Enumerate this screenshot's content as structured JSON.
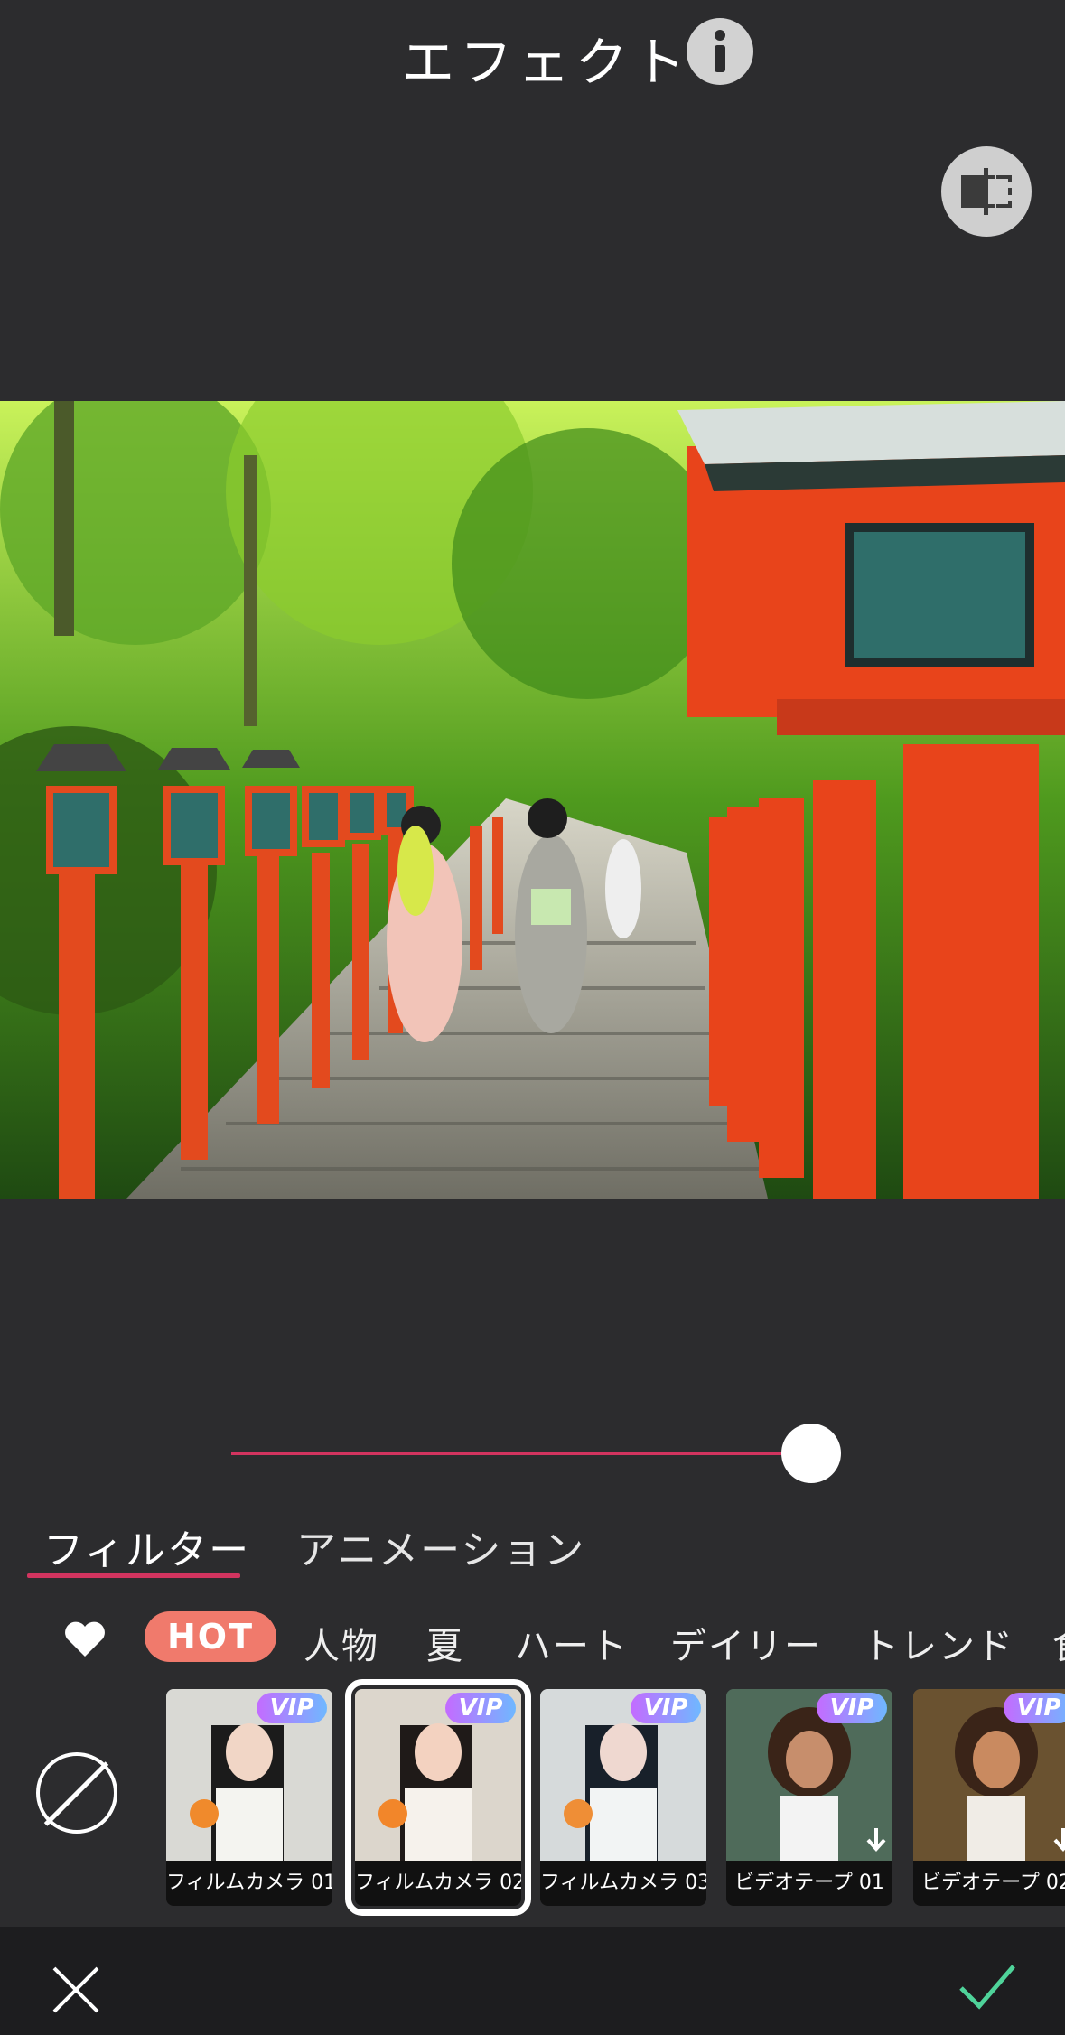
{
  "header": {
    "title": "エフェクト"
  },
  "slider": {
    "value_fraction": 0.96
  },
  "tabs": [
    {
      "label": "フィルター",
      "active": true
    },
    {
      "label": "アニメーション",
      "active": false
    }
  ],
  "categories": {
    "items": [
      "HOT",
      "人物",
      "夏",
      "ハート",
      "デイリー",
      "トレンド",
      "食"
    ],
    "selected": "HOT"
  },
  "filters": [
    {
      "label": "フィルムカメラ 01",
      "badge": "VIP",
      "selected": false
    },
    {
      "label": "フィルムカメラ 02",
      "badge": "VIP",
      "selected": true
    },
    {
      "label": "フィルムカメラ 03",
      "badge": "VIP",
      "selected": false
    },
    {
      "label": "ビデオテープ 01",
      "badge": "VIP",
      "selected": false
    },
    {
      "label": "ビデオテープ 02",
      "badge": "VIP",
      "selected": false
    }
  ],
  "colors": {
    "background": "#2c2c2e",
    "accent": "#d2345f",
    "hot": "#f07a6c",
    "confirm": "#4fd39a"
  },
  "icons": {
    "info": "info-icon",
    "compare": "compare-icon",
    "favorite": "heart-icon",
    "none": "no-filter-icon",
    "cancel": "close-icon",
    "confirm": "check-icon",
    "download": "download-icon"
  }
}
